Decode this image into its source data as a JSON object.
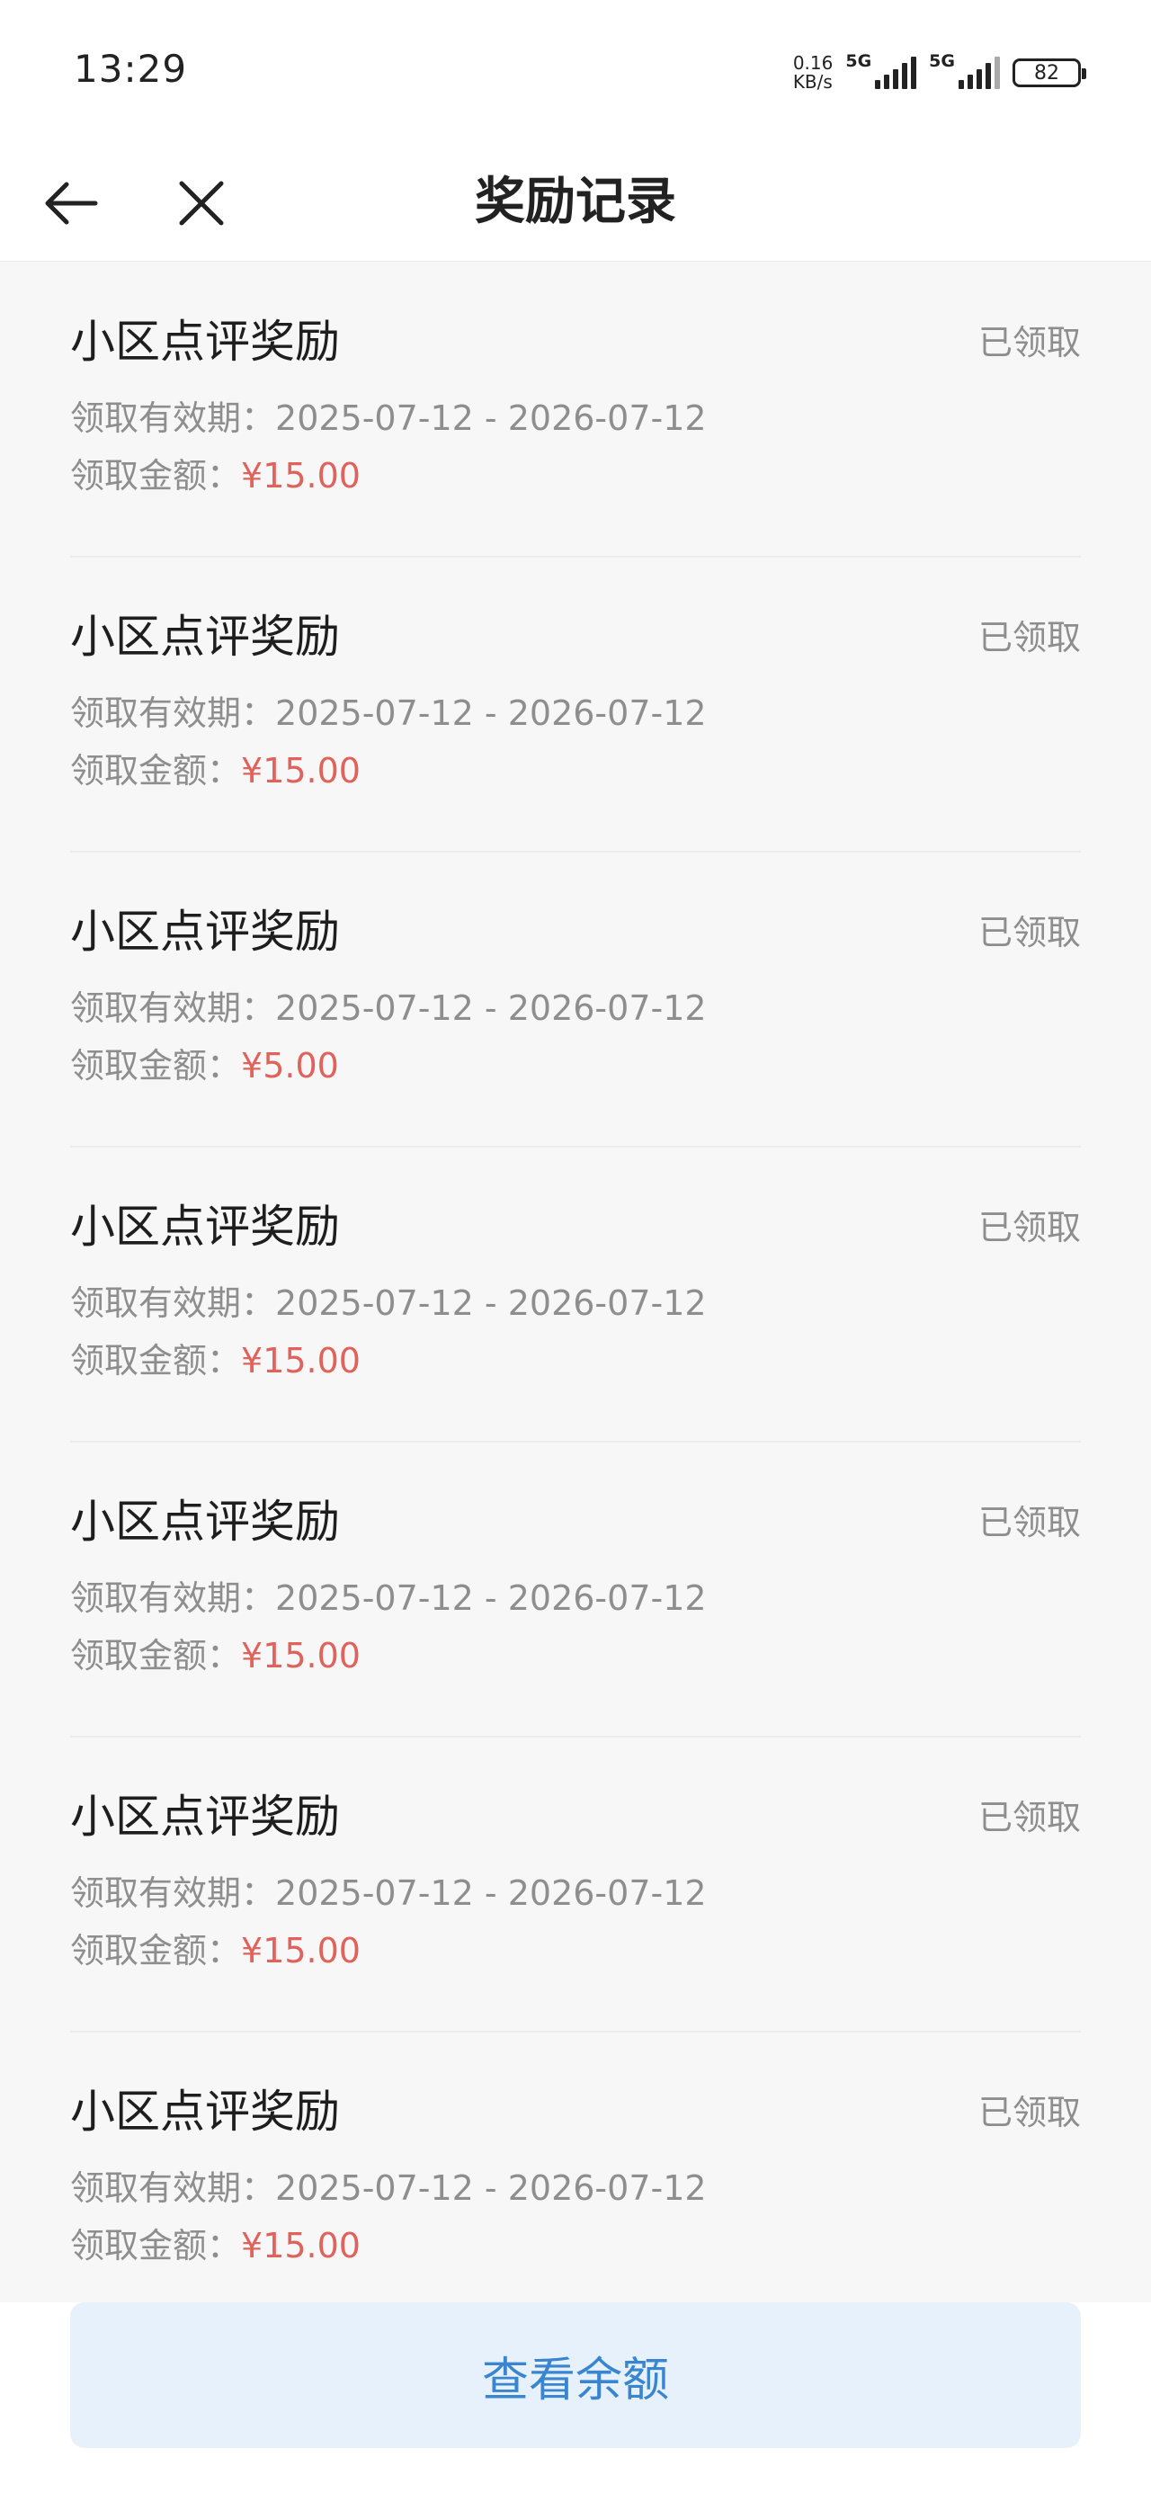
{
  "status_bar": {
    "time": "13:29",
    "net_speed_value": "0.16",
    "net_speed_unit": "KB/s",
    "sim1_label": "5G",
    "sim2_label": "5G",
    "battery": "82"
  },
  "nav": {
    "back_icon": "arrow-left-icon",
    "close_icon": "close-icon",
    "title": "奖励记录"
  },
  "records": [
    {
      "title": "小区点评奖励",
      "status": "已领取",
      "period_label": "领取有效期：",
      "period": "2025-07-12 - 2026-07-12",
      "amount_label": "领取金额：",
      "amount": "¥15.00"
    },
    {
      "title": "小区点评奖励",
      "status": "已领取",
      "period_label": "领取有效期：",
      "period": "2025-07-12 - 2026-07-12",
      "amount_label": "领取金额：",
      "amount": "¥15.00"
    },
    {
      "title": "小区点评奖励",
      "status": "已领取",
      "period_label": "领取有效期：",
      "period": "2025-07-12 - 2026-07-12",
      "amount_label": "领取金额：",
      "amount": "¥5.00"
    },
    {
      "title": "小区点评奖励",
      "status": "已领取",
      "period_label": "领取有效期：",
      "period": "2025-07-12 - 2026-07-12",
      "amount_label": "领取金额：",
      "amount": "¥15.00"
    },
    {
      "title": "小区点评奖励",
      "status": "已领取",
      "period_label": "领取有效期：",
      "period": "2025-07-12 - 2026-07-12",
      "amount_label": "领取金额：",
      "amount": "¥15.00"
    },
    {
      "title": "小区点评奖励",
      "status": "已领取",
      "period_label": "领取有效期：",
      "period": "2025-07-12 - 2026-07-12",
      "amount_label": "领取金额：",
      "amount": "¥15.00"
    },
    {
      "title": "小区点评奖励",
      "status": "已领取",
      "period_label": "领取有效期：",
      "period": "2025-07-12 - 2026-07-12",
      "amount_label": "领取金额：",
      "amount": "¥15.00"
    }
  ],
  "bottom": {
    "balance_button": "查看余额"
  },
  "colors": {
    "amount": "#e0625a",
    "button_bg": "#e7f1fb",
    "button_text": "#3a85cf",
    "page_bg": "#f7f7f7"
  }
}
